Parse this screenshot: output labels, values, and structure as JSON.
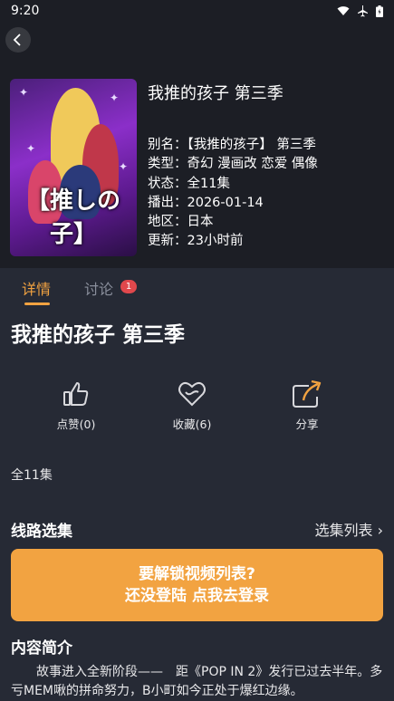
{
  "status_bar": {
    "time": "9:20",
    "icons": [
      "wifi-icon",
      "airplane-icon",
      "battery-icon"
    ]
  },
  "header": {
    "back_icon": "chevron-left-icon"
  },
  "poster": {
    "title_text": "【推しの子】"
  },
  "detail": {
    "title": "我推的孩子 第三季",
    "info": [
      {
        "label": "别名：",
        "value": "【我推的孩子】 第三季"
      },
      {
        "label": "类型：",
        "value": "奇幻 漫画改 恋爱 偶像"
      },
      {
        "label": "状态：",
        "value": "全11集"
      },
      {
        "label": "播出：",
        "value": "2026-01-14"
      },
      {
        "label": "地区：",
        "value": "日本"
      },
      {
        "label": "更新：",
        "value": "23小时前"
      }
    ]
  },
  "tabs": [
    {
      "label": "详情",
      "active": true
    },
    {
      "label": "讨论",
      "badge": "1"
    }
  ],
  "main_title": "我推的孩子 第三季",
  "actions": [
    {
      "label": "点赞(0)",
      "icon": "thumbs-up-icon"
    },
    {
      "label": "收藏(6)",
      "icon": "heart-icon"
    },
    {
      "label": "分享",
      "icon": "share-icon"
    }
  ],
  "episodes_count": "全11集",
  "route_section": {
    "title": "线路选集",
    "more": "选集列表 ›"
  },
  "login_prompt": {
    "line1": "要解锁视频列表?",
    "line2": "还没登陆 点我去登录"
  },
  "intro": {
    "title": "内容简介",
    "text": "故事进入全新阶段——　距《POP IN 2》发行已过去半年。多亏MEM啾的拼命努力，B小町如今正处于爆红边缘。"
  },
  "colors": {
    "accent": "#f2a341",
    "background": "#262a35",
    "badge": "#e0484c"
  }
}
